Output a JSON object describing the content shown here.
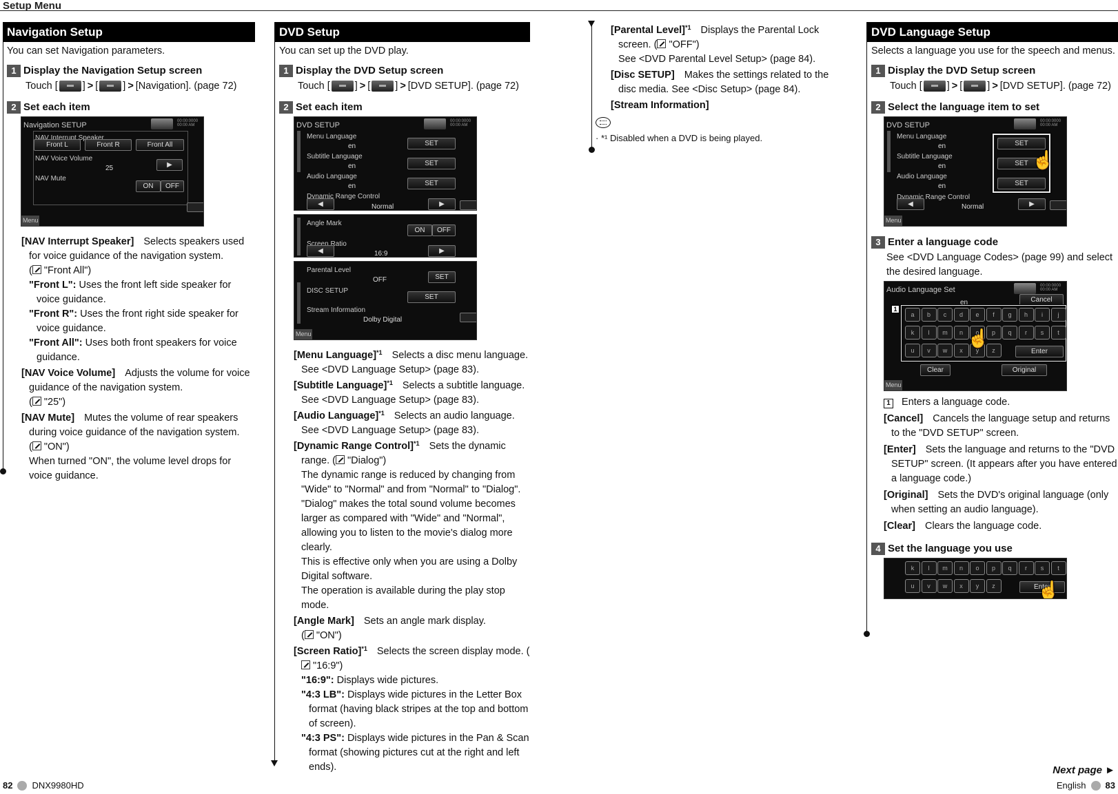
{
  "header": {
    "title": "Setup Menu"
  },
  "navigation_setup": {
    "title": "Navigation Setup",
    "intro": "You can set Navigation parameters.",
    "step1": {
      "num": "1",
      "title": "Display the Navigation Setup screen",
      "touch": "Touch [",
      "sep1": "]",
      "sep2": "[",
      "sep3": "]",
      "dest": "[Navigation]. (page 72)"
    },
    "step2": {
      "num": "2",
      "title": "Set each item"
    },
    "screen": {
      "title": "Navigation SETUP",
      "clock": "00:00:0000 00:00 AM",
      "label_speaker": "NAV Interrupt Speaker",
      "btn_front_l": "Front L",
      "btn_front_r": "Front R",
      "btn_front_all": "Front All",
      "label_volume": "NAV Voice Volume",
      "volume_value": "25",
      "label_mute": "NAV Mute",
      "btn_on": "ON",
      "btn_off": "OFF",
      "menu": "Menu"
    },
    "items": [
      {
        "label": "[NAV Interrupt Speaker]",
        "desc": "Selects speakers used for voice guidance of the navigation system.",
        "default": "\"Front All\")",
        "subs": [
          {
            "label": "\"Front L\":",
            "text": "Uses the front left side speaker for voice guidance."
          },
          {
            "label": "\"Front R\":",
            "text": "Uses the front right side speaker for voice guidance."
          },
          {
            "label": "\"Front All\":",
            "text": "Uses both front speakers for voice guidance."
          }
        ]
      },
      {
        "label": "[NAV Voice Volume]",
        "desc": "Adjusts the volume for voice guidance of the navigation system.",
        "default": "\"25\")"
      },
      {
        "label": "[NAV Mute]",
        "desc": "Mutes the volume of rear speakers during voice guidance of the navigation system.",
        "default": "\"ON\")",
        "extra": "When turned \"ON\", the volume level drops for voice guidance."
      }
    ]
  },
  "dvd_setup": {
    "title": "DVD Setup",
    "intro": "You can set up the DVD play.",
    "step1": {
      "num": "1",
      "title": "Display the DVD Setup screen",
      "touch": "Touch [",
      "sep1": "]",
      "sep2": "[",
      "sep3": "]",
      "dest": "[DVD SETUP]. (page 72)"
    },
    "step2": {
      "num": "2",
      "title": "Set each item"
    },
    "screen1": {
      "title": "DVD SETUP",
      "clock": "00:00:0000 00:00 AM",
      "rows": [
        {
          "label": "Menu Language",
          "value": "en",
          "button": "SET"
        },
        {
          "label": "Subtitle Language",
          "value": "en",
          "button": "SET"
        },
        {
          "label": "Audio Language",
          "value": "en",
          "button": "SET"
        }
      ],
      "drc_label": "Dynamic Range Control",
      "drc_value": "Normal"
    },
    "screen2": {
      "angle_label": "Angle Mark",
      "btn_on": "ON",
      "btn_off": "OFF",
      "ratio_label": "Screen Ratio",
      "ratio_value": "16:9"
    },
    "screen3": {
      "parental_label": "Parental Level",
      "parental_value": "OFF",
      "parental_button": "SET",
      "disc_label": "DISC SETUP",
      "disc_button": "SET",
      "stream_label": "Stream Information",
      "stream_value": "Dolby Digital",
      "menu": "Menu"
    },
    "items": [
      {
        "label": "[Menu Language]",
        "sup": "*1",
        "desc": "Selects a disc menu language. See <DVD Language Setup> (page 83)."
      },
      {
        "label": "[Subtitle Language]",
        "sup": "*1",
        "desc": "Selects a subtitle language. See <DVD Language Setup> (page 83)."
      },
      {
        "label": "[Audio Language]",
        "sup": "*1",
        "desc": "Selects an audio language. See <DVD Language Setup> (page 83)."
      },
      {
        "label": "[Dynamic Range Control]",
        "sup": "*1",
        "desc": "Sets the dynamic range. (",
        "default": "\"Dialog\")",
        "paras": [
          "The dynamic range is reduced by changing from \"Wide\" to \"Normal\" and from \"Normal\" to \"Dialog\". \"Dialog\" makes the total sound volume becomes larger as compared with \"Wide\" and \"Normal\", allowing you to listen to the movie's dialog more clearly.",
          "This is effective only when you are using a Dolby Digital software.",
          "The operation is available during the play stop mode."
        ]
      },
      {
        "label": "[Angle Mark]",
        "desc": "Sets an angle mark display.",
        "default": "\"ON\")"
      },
      {
        "label": "[Screen Ratio]",
        "sup": "*1",
        "desc": "Selects the screen display mode. (",
        "default": "\"16:9\")",
        "subs": [
          {
            "label": "\"16:9\":",
            "text": "Displays wide pictures."
          },
          {
            "label": "\"4:3 LB\":",
            "text": "Displays wide pictures in the Letter Box format (having black stripes at the top and bottom of screen)."
          },
          {
            "label": "\"4:3 PS\":",
            "text": "Displays wide pictures in the Pan & Scan format (showing pictures cut at the right and left ends)."
          }
        ]
      }
    ],
    "cont_items": [
      {
        "label": "[Parental Level]",
        "sup": "*1",
        "desc": "Displays the Parental Lock screen. (",
        "default": "\"OFF\")",
        "extra": "See <DVD Parental Level Setup> (page 84)."
      },
      {
        "label": "[Disc SETUP]",
        "desc": "Makes the settings related to the disc media. See <Disc Setup> (page 84)."
      },
      {
        "label": "[Stream Information]"
      }
    ],
    "note": "· *¹ Disabled when a DVD is being played."
  },
  "dvd_language_setup": {
    "title": "DVD Language Setup",
    "intro": "Selects a language you use for the speech and menus.",
    "step1": {
      "num": "1",
      "title": "Display the DVD Setup screen",
      "touch": "Touch [",
      "sep1": "]",
      "sep2": "[",
      "sep3": "]",
      "dest": "[DVD SETUP]. (page 72)"
    },
    "step2": {
      "num": "2",
      "title": "Select the language item to set"
    },
    "step3": {
      "num": "3",
      "title": "Enter a language code",
      "body": "See <DVD Language Codes> (page 99) and select the desired language."
    },
    "step4": {
      "num": "4",
      "title": "Set the language you use"
    },
    "keyboard_screen": {
      "title": "Audio Language Set",
      "value": "en",
      "cancel": "Cancel",
      "enter": "Enter",
      "clear": "Clear",
      "original": "Original",
      "menu": "Menu",
      "callout": "1",
      "row1": [
        "a",
        "b",
        "c",
        "d",
        "e",
        "f",
        "g",
        "h",
        "i",
        "j"
      ],
      "row2": [
        "k",
        "l",
        "m",
        "n",
        "o",
        "p",
        "q",
        "r",
        "s",
        "t"
      ],
      "row3": [
        "u",
        "v",
        "w",
        "x",
        "y",
        "z"
      ]
    },
    "items": [
      {
        "callout": "1",
        "desc": "Enters a language code."
      },
      {
        "label": "[Cancel]",
        "desc": "Cancels the language setup and returns to the \"DVD SETUP\" screen."
      },
      {
        "label": "[Enter]",
        "desc": "Sets the language and returns to the \"DVD SETUP\" screen. (It appears after you have entered a language code.)"
      },
      {
        "label": "[Original]",
        "desc": "Sets the DVD's original language (only when setting an audio language)."
      },
      {
        "label": "[Clear]",
        "desc": "Clears the language code."
      }
    ]
  },
  "footer": {
    "left_page": "82",
    "model": "DNX9980HD",
    "next_page": "Next page ►",
    "language": "English",
    "right_page": "83"
  }
}
